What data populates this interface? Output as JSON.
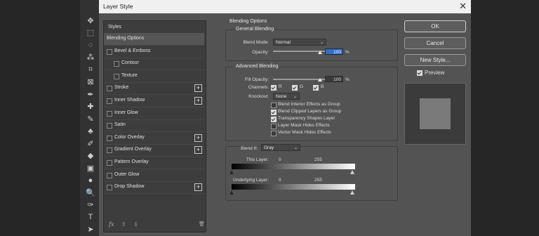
{
  "dialog": {
    "title": "Layer Style",
    "close_glyph": "✕"
  },
  "styles_panel": {
    "header": "Styles",
    "items": [
      {
        "label": "Blending Options",
        "checkbox": false,
        "indent": 0,
        "plus": false,
        "selected": true
      },
      {
        "label": "Bevel & Emboss",
        "checkbox": true,
        "indent": 0,
        "plus": false,
        "selected": false
      },
      {
        "label": "Contour",
        "checkbox": true,
        "indent": 1,
        "plus": false,
        "selected": false
      },
      {
        "label": "Texture",
        "checkbox": true,
        "indent": 1,
        "plus": false,
        "selected": false
      },
      {
        "label": "Stroke",
        "checkbox": true,
        "indent": 0,
        "plus": true,
        "selected": false
      },
      {
        "label": "Inner Shadow",
        "checkbox": true,
        "indent": 0,
        "plus": true,
        "selected": false
      },
      {
        "label": "Inner Glow",
        "checkbox": true,
        "indent": 0,
        "plus": false,
        "selected": false
      },
      {
        "label": "Satin",
        "checkbox": true,
        "indent": 0,
        "plus": false,
        "selected": false
      },
      {
        "label": "Color Overlay",
        "checkbox": true,
        "indent": 0,
        "plus": true,
        "selected": false
      },
      {
        "label": "Gradient Overlay",
        "checkbox": true,
        "indent": 0,
        "plus": true,
        "selected": false
      },
      {
        "label": "Pattern Overlay",
        "checkbox": true,
        "indent": 0,
        "plus": false,
        "selected": false
      },
      {
        "label": "Outer Glow",
        "checkbox": true,
        "indent": 0,
        "plus": false,
        "selected": false
      },
      {
        "label": "Drop Shadow",
        "checkbox": true,
        "indent": 0,
        "plus": true,
        "selected": false
      }
    ],
    "bottom_icons": {
      "fx": "fx",
      "up": "⇧",
      "down": "⇩",
      "trash": "🗑"
    }
  },
  "blending": {
    "section_title": "Blending Options",
    "general": {
      "title": "General Blending",
      "blend_mode_label": "Blend Mode:",
      "blend_mode_value": "Normal",
      "opacity_label": "Opacity:",
      "opacity_value": "100",
      "opacity_unit": "%"
    },
    "advanced": {
      "title": "Advanced Blending",
      "fill_opacity_label": "Fill Opacity:",
      "fill_opacity_value": "100",
      "fill_opacity_unit": "%",
      "channels_label": "Channels:",
      "channels": [
        {
          "label": "R",
          "checked": true
        },
        {
          "label": "G",
          "checked": true
        },
        {
          "label": "B",
          "checked": true
        }
      ],
      "knockout_label": "Knockout:",
      "knockout_value": "None",
      "options": [
        {
          "label": "Blend Interior Effects as Group",
          "checked": false
        },
        {
          "label": "Blend Clipped Layers as Group",
          "checked": true
        },
        {
          "label": "Transparency Shapes Layer",
          "checked": true
        },
        {
          "label": "Layer Mask Hides Effects",
          "checked": false
        },
        {
          "label": "Vector Mask Hides Effects",
          "checked": false
        }
      ]
    },
    "blend_if": {
      "label": "Blend If:",
      "value": "Gray",
      "this_layer_label": "This Layer:",
      "this_layer_min": "0",
      "this_layer_max": "255",
      "underlying_label": "Underlying Layer:",
      "underlying_min": "0",
      "underlying_max": "255"
    }
  },
  "buttons": {
    "ok": "OK",
    "cancel": "Cancel",
    "new_style": "New Style..."
  },
  "preview": {
    "label": "Preview",
    "checked": true
  },
  "tools": [
    "move-tool-icon",
    "marquee-tool-icon",
    "lasso-tool-icon",
    "magic-wand-tool-icon",
    "crop-tool-icon",
    "frame-tool-icon",
    "eyedropper-tool-icon",
    "healing-brush-tool-icon",
    "brush-tool-icon",
    "clone-stamp-tool-icon",
    "history-brush-tool-icon",
    "eraser-tool-icon",
    "gradient-tool-icon",
    "blur-tool-icon",
    "dodge-tool-icon",
    "pen-tool-icon",
    "type-tool-icon",
    "path-selection-tool-icon"
  ],
  "tool_glyphs": [
    "✥",
    "⬚",
    "◌",
    "⁂",
    "⌗",
    "⊠",
    "✒",
    "✚",
    "✎",
    "♣",
    "✐",
    "◆",
    "▣",
    "●",
    "🔍",
    "✑",
    "T",
    "➤"
  ]
}
